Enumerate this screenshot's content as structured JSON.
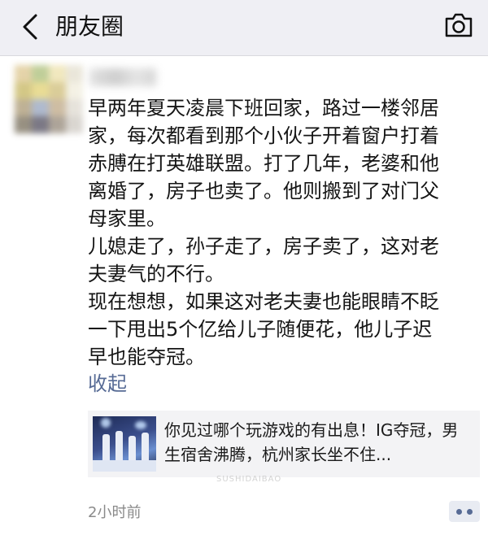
{
  "nav": {
    "title": "朋友圈",
    "back_icon": "chevron-left-icon",
    "camera_icon": "camera-icon",
    "background": "#efeff4"
  },
  "post": {
    "avatar_icon": "avatar-blurred",
    "text": "早两年夏天凌晨下班回家，路过一楼邻居\n家，每次都看到那个小伙子开着窗户打着\n赤膊在打英雄联盟。打了几年，老婆和他\n离婚了，房子也卖了。他则搬到了对门父\n母家里。\n儿媳走了，孙子走了，房子卖了，这对老\n夫妻气的不行。\n现在想想，如果这对老夫妻也能眼睛不眨\n一下甩出5个亿给儿子随便花，他儿子迟\n早也能夺冠。",
    "collapse_label": "收起",
    "link_color": "#576b95",
    "shared_link": {
      "title": "你见过哪个玩游戏的有出息！IG夺冠，男生宿舍沸腾，杭州家长坐不住..."
    },
    "timestamp": "2小时前",
    "comment_icon": "comment-dots-icon"
  },
  "watermark": "SUSHIDAIBAO"
}
